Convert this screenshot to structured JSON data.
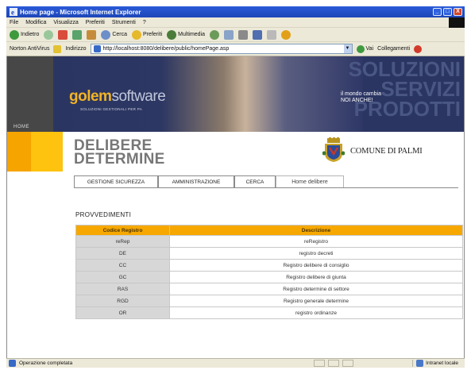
{
  "window": {
    "title": "Home page - Microsoft Internet Explorer",
    "buttons": [
      "_",
      "□",
      "X"
    ]
  },
  "menu": [
    "File",
    "Modifica",
    "Visualizza",
    "Preferiti",
    "Strumenti",
    "?"
  ],
  "toolbar": {
    "back": "Indietro",
    "search": "Cerca",
    "favorites": "Preferiti",
    "multimedia": "Multimedia"
  },
  "address": {
    "links_label": "Norton AntiVirus",
    "label": "Indirizzo",
    "url": "http://localhost:8080/delibere/public/homePage.asp",
    "go": "Vai",
    "links": "Collegamenti"
  },
  "banner": {
    "home": "HOME",
    "logo_a": "golem",
    "logo_b": "software",
    "tagline": "SOLUZIONI GESTIONALI PER PA",
    "big_lines": [
      "SOLUZIONI",
      "SERVIZI",
      "PRODOTTI"
    ],
    "slogan_lines": [
      "il mondo cambia",
      "NOI ANCHE!"
    ]
  },
  "header": {
    "title_line1": "DELIBERE",
    "title_line2": "DETERMINE",
    "comune": "COMUNE DI PALMI"
  },
  "tabs": [
    {
      "label": "GESTIONE SICUREZZA"
    },
    {
      "label": "AMMINISTRAZIONE"
    },
    {
      "label": "CERCA"
    },
    {
      "label": "Home delibere"
    }
  ],
  "section_title": "PROVVEDIMENTI",
  "table": {
    "headers": [
      "Codice Registro",
      "Descrizione"
    ],
    "rows": [
      {
        "code": "reRep",
        "desc": "reRegistro"
      },
      {
        "code": "DE",
        "desc": "registro decreti"
      },
      {
        "code": "CC",
        "desc": "Registro delibere di consiglio"
      },
      {
        "code": "GC",
        "desc": "Registro delibere di giunta"
      },
      {
        "code": "RAS",
        "desc": "Registro determine di settore"
      },
      {
        "code": "RGD",
        "desc": "Registro generale determine"
      },
      {
        "code": "OR",
        "desc": "registro ordinanze"
      }
    ]
  },
  "status": {
    "text": "Operazione completata",
    "zone": "Intranet locale"
  }
}
